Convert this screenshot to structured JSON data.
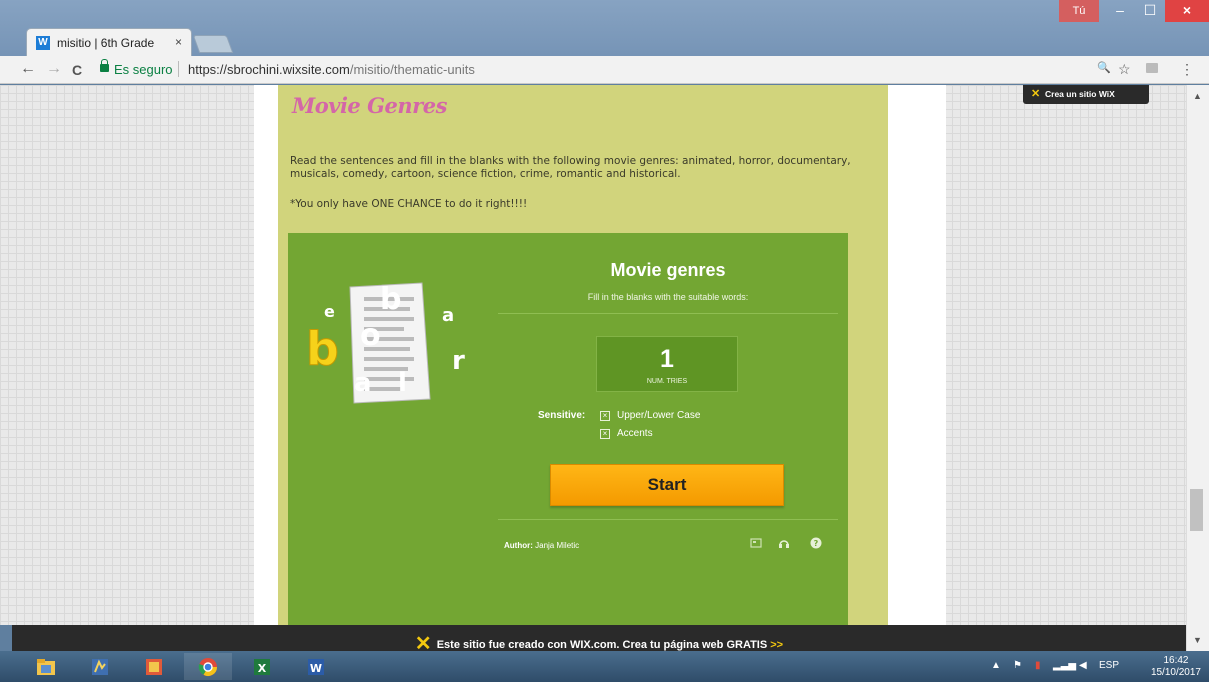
{
  "browser": {
    "tab_title": "misitio | 6th Grade",
    "tab_close": "×",
    "user_label": "Tú",
    "minimize": "–",
    "maximize": "☐",
    "close": "×",
    "secure_label": "Es seguro",
    "url_host": "https://sbrochini.wixsite.com",
    "url_path": "/misitio/thematic-units",
    "back_icon": "←",
    "forward_icon": "→",
    "reload_icon": "C",
    "zoom_icon": "🔍",
    "star_icon": "☆",
    "menu_icon": "⋮"
  },
  "page": {
    "heading": "Movie Genres",
    "instructions": "Read the sentences and fill in the blanks with the following movie genres: animated, horror, documentary, musicals, comedy, cartoon, science fiction, crime, romantic and historical.",
    "warning": "*You only have ONE CHANCE to do it right!!!!"
  },
  "game": {
    "title": "Movie genres",
    "subtitle": "Fill in the blanks with the suitable words:",
    "tries_value": "1",
    "tries_label": "NUM. TRIES",
    "sensitive_label": "Sensitive:",
    "option_case": "Upper/Lower Case",
    "option_accents": "Accents",
    "check_mark": "×",
    "start_label": "Start",
    "author_label": "Author:",
    "author_name": "Janja Miletic",
    "logo_letters": [
      "e",
      "b",
      "a",
      "o",
      "r",
      "b",
      "a",
      "l"
    ]
  },
  "wix": {
    "badge": "Crea un sitio WiX",
    "banner_pre": "Este sitio fue creado con",
    "banner_brand": "WIX.com",
    "banner_post": ". Crea tu página web GRATIS",
    "banner_arrow": ">>"
  },
  "taskbar": {
    "lang": "ESP",
    "time": "16:42",
    "date": "15/10/2017"
  },
  "colors": {
    "page_bg": "#d1d47c",
    "game_green": "#73a633",
    "heading_pink": "#d466a8",
    "start_orange": "#f7a200",
    "wix_yellow": "#f3c80f"
  }
}
